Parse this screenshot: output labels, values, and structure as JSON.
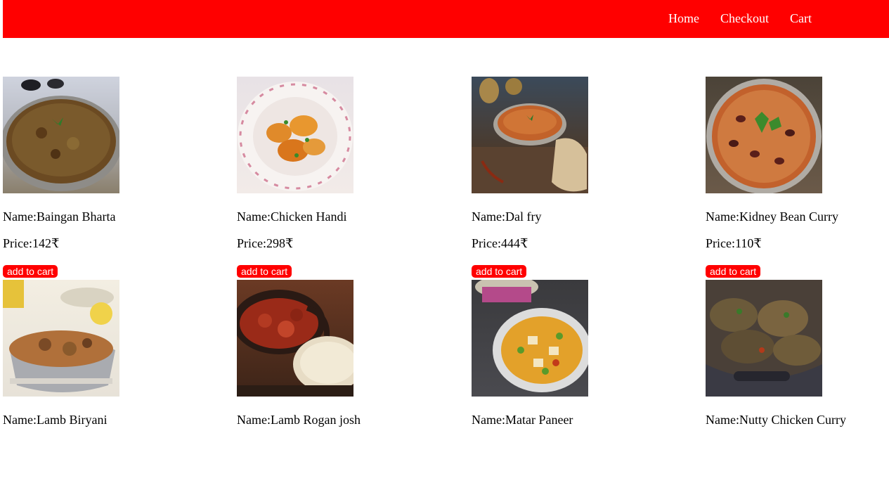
{
  "nav": {
    "links": [
      "Home",
      "Checkout",
      "Cart"
    ]
  },
  "products": [
    {
      "name": "Name:Baingan Bharta",
      "price": "Price:142₹",
      "button": "add to cart",
      "image": "baingan-bharta-photo"
    },
    {
      "name": "Name:Chicken Handi",
      "price": "Price:298₹",
      "button": "add to cart",
      "image": "chicken-handi-photo"
    },
    {
      "name": "Name:Dal fry",
      "price": "Price:444₹",
      "button": "add to cart",
      "image": "dal-fry-photo"
    },
    {
      "name": "Name:Kidney Bean Curry",
      "price": "Price:110₹",
      "button": "add to cart",
      "image": "kidney-bean-curry-photo"
    },
    {
      "name": "Name:Lamb Biryani",
      "price": "",
      "button": "",
      "image": "lamb-biryani-photo"
    },
    {
      "name": "Name:Lamb Rogan josh",
      "price": "",
      "button": "",
      "image": "lamb-rogan-josh-photo"
    },
    {
      "name": "Name:Matar Paneer",
      "price": "",
      "button": "",
      "image": "matar-paneer-photo"
    },
    {
      "name": "Name:Nutty Chicken Curry",
      "price": "",
      "button": "",
      "image": "nutty-chicken-curry-photo"
    }
  ],
  "colors": {
    "accent": "#ff0000",
    "text": "#000000",
    "nav_text": "#ffffff"
  }
}
